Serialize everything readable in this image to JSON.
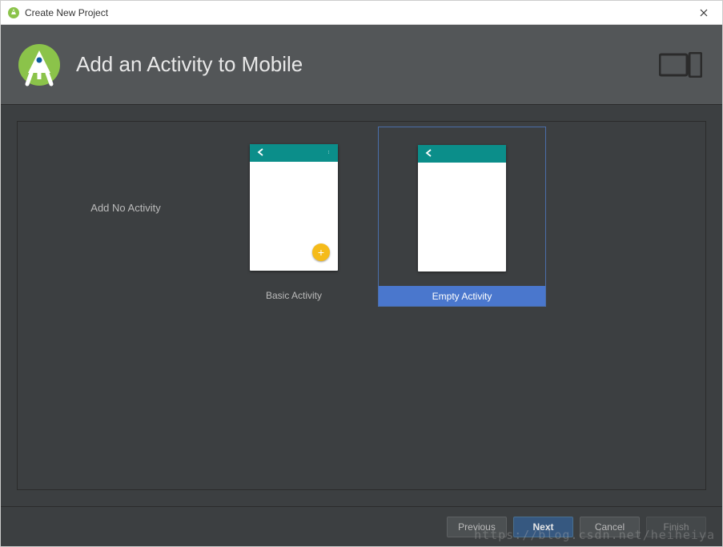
{
  "window": {
    "title": "Create New Project"
  },
  "header": {
    "title": "Add an Activity to Mobile"
  },
  "templates": {
    "no_activity": {
      "label": "Add No Activity"
    },
    "basic": {
      "label": "Basic Activity"
    },
    "empty": {
      "label": "Empty Activity"
    }
  },
  "footer": {
    "previous": "Previous",
    "next": "Next",
    "cancel": "Cancel",
    "finish": "Finish"
  },
  "watermark": "https://blog.csdn.net/heiheiya"
}
